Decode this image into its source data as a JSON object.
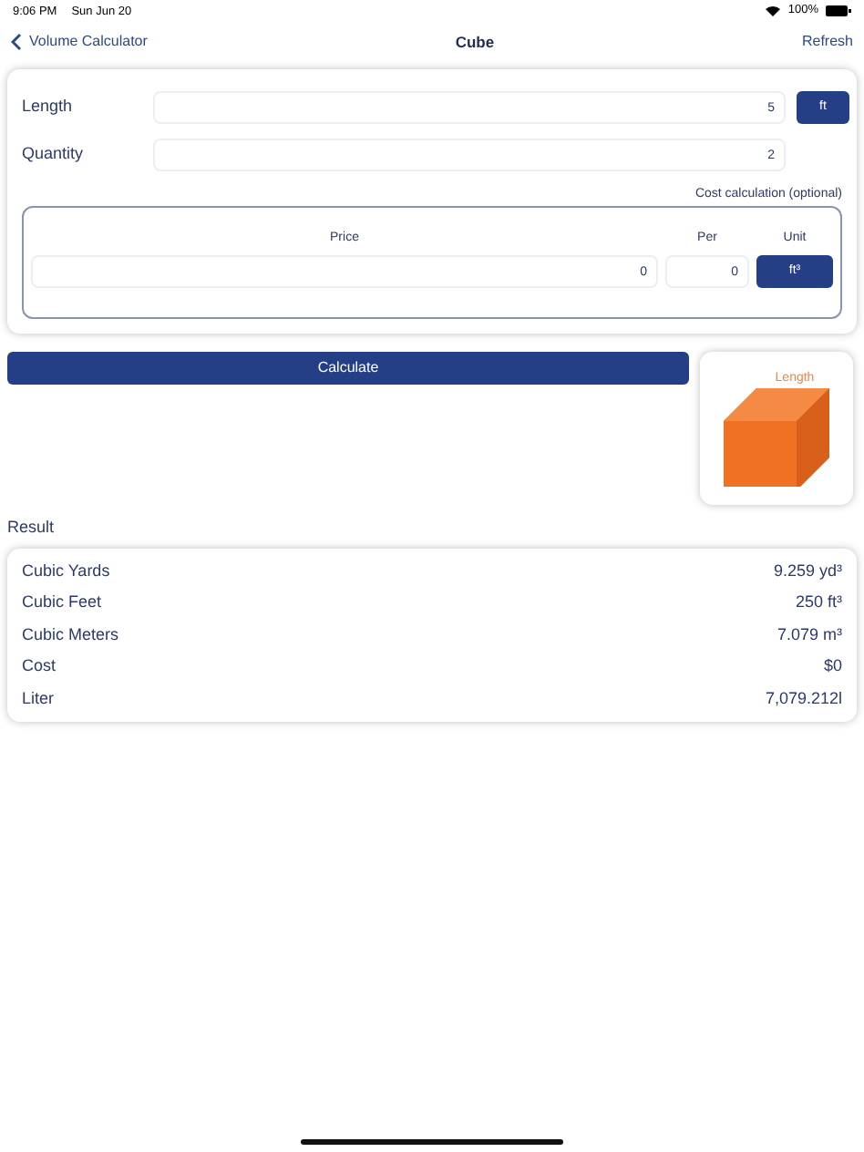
{
  "status_bar": {
    "time": "9:06 PM",
    "date": "Sun Jun 20",
    "battery": "100%"
  },
  "nav": {
    "back": "Volume Calculator",
    "title": "Cube",
    "action": "Refresh"
  },
  "inputs": [
    {
      "label": "Length",
      "value": "5",
      "unit": "ft"
    },
    {
      "label": "Quantity",
      "value": "2"
    }
  ],
  "cost": {
    "title": "Cost calculation (optional)",
    "price_label": "Price",
    "price": "0",
    "per_label": "Per",
    "per": "0",
    "unit_label": "Unit",
    "unit": "ft³"
  },
  "calculate": "Calculate",
  "diagram": {
    "label": "Length"
  },
  "result": {
    "title": "Result",
    "rows": [
      {
        "label": "Cubic Yards",
        "value": "9.259 yd³"
      },
      {
        "label": "Cubic Feet",
        "value": "250 ft³"
      },
      {
        "label": "Cubic Meters",
        "value": "7.079 m³"
      },
      {
        "label": "Cost",
        "value": "$0"
      },
      {
        "label": "Liter",
        "value": "7,079.212l"
      }
    ]
  }
}
